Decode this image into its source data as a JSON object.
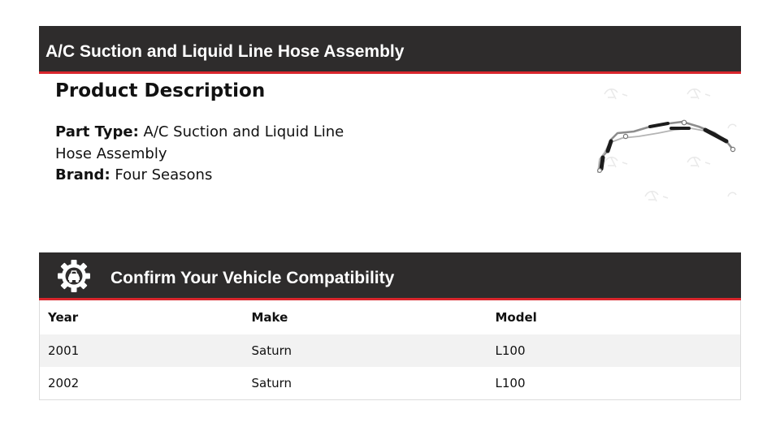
{
  "title_bar": {
    "title": "A/C Suction and Liquid Line Hose Assembly"
  },
  "description": {
    "heading": "Product Description",
    "part_type_label": "Part Type:",
    "part_type_value": "A/C Suction and Liquid Line Hose Assembly",
    "brand_label": "Brand:",
    "brand_value": "Four Seasons"
  },
  "compatibility": {
    "title": "Confirm Your Vehicle Compatibility",
    "columns": [
      "Year",
      "Make",
      "Model"
    ],
    "rows": [
      [
        "2001",
        "Saturn",
        "L100"
      ],
      [
        "2002",
        "Saturn",
        "L100"
      ]
    ]
  },
  "colors": {
    "bar_background": "#2e2c2c",
    "bar_accent": "#d8262c",
    "stripe_row": "#f2f2f2"
  }
}
